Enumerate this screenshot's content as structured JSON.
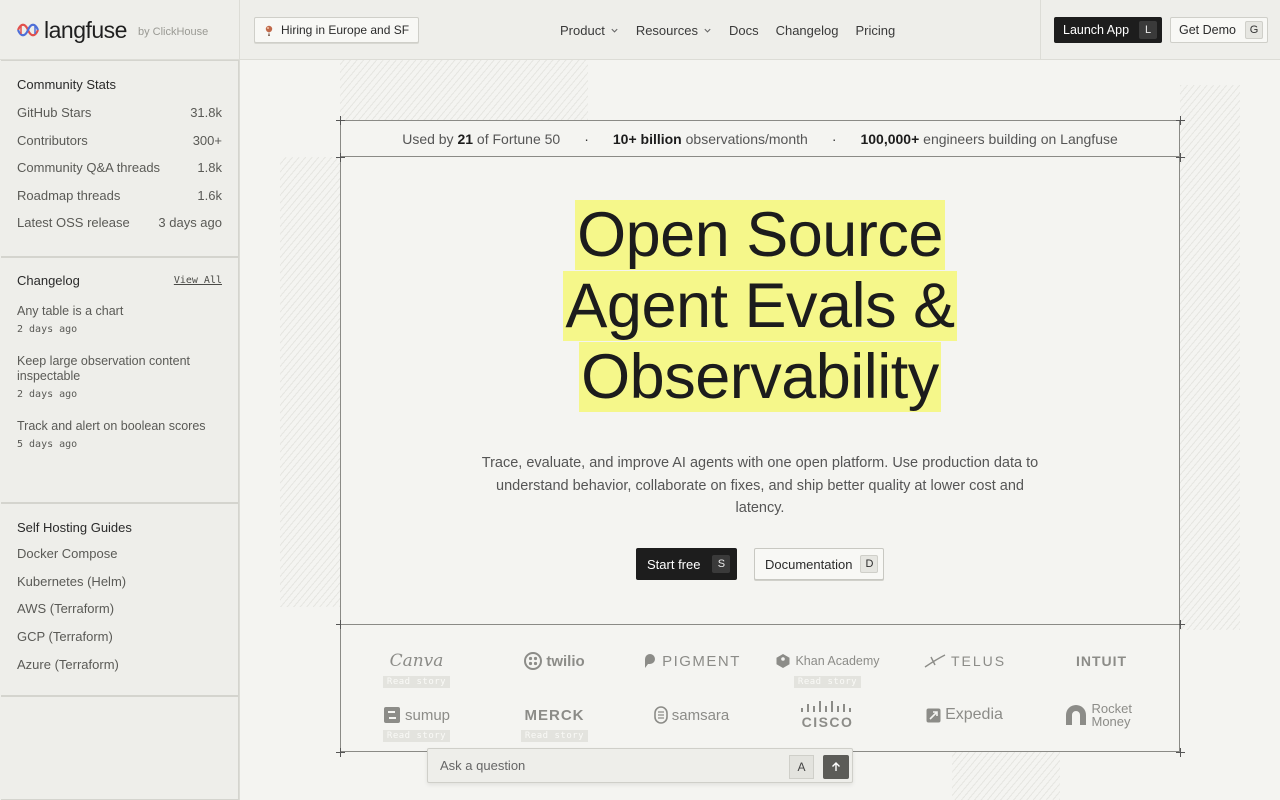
{
  "header": {
    "logo_text": "langfuse",
    "logo_by": "by ClickHouse",
    "hiring": "Hiring in Europe and SF",
    "nav": [
      {
        "label": "Product"
      },
      {
        "label": "Resources"
      },
      {
        "label": "Docs"
      },
      {
        "label": "Changelog"
      },
      {
        "label": "Pricing"
      }
    ],
    "launch": {
      "label": "Launch App",
      "key": "L"
    },
    "demo": {
      "label": "Get Demo",
      "key": "G"
    }
  },
  "sidebar": {
    "community": {
      "title": "Community Stats",
      "rows": [
        {
          "label": "GitHub Stars",
          "value": "31.8k"
        },
        {
          "label": "Contributors",
          "value": "300+"
        },
        {
          "label": "Community Q&A threads",
          "value": "1.8k"
        },
        {
          "label": "Roadmap threads",
          "value": "1.6k"
        },
        {
          "label": "Latest OSS release",
          "value": "3 days ago"
        }
      ]
    },
    "changelog": {
      "title": "Changelog",
      "view_all": "View All",
      "items": [
        {
          "title": "Any table is a chart",
          "date": "2 days ago"
        },
        {
          "title": "Keep large observation content inspectable",
          "date": "2 days ago"
        },
        {
          "title": "Track and alert on boolean scores",
          "date": "5 days ago"
        }
      ]
    },
    "guides": {
      "title": "Self Hosting Guides",
      "items": [
        "Docker Compose",
        "Kubernetes (Helm)",
        "AWS (Terraform)",
        "GCP (Terraform)",
        "Azure (Terraform)"
      ]
    }
  },
  "stats": {
    "s1_pre": "Used by",
    "s1_bold": "21",
    "s1_post": "of Fortune 50",
    "sep": "·",
    "s2_bold": "10+ billion",
    "s2_post": "observations/month",
    "s3_bold": "100,000+",
    "s3_post": "engineers building on Langfuse"
  },
  "hero": {
    "line1": "Open Source",
    "line2": "Agent Evals &",
    "line3": "Observability",
    "subtitle": "Trace, evaluate, and improve AI agents with one open platform. Use production data to understand behavior, collaborate on fixes, and ship better quality at lower cost and latency.",
    "cta_primary": {
      "label": "Start free",
      "key": "S"
    },
    "cta_secondary": {
      "label": "Documentation",
      "key": "D"
    }
  },
  "logos": {
    "read_story": "Read story",
    "row1": [
      "Canva",
      "twilio",
      "PIGMENT",
      "Khan Academy",
      "TELUS",
      "INTUIT"
    ],
    "row2": [
      "sumup",
      "MERCK",
      "samsara",
      "CISCO",
      "Expedia",
      "Rocket Money"
    ]
  },
  "ask": {
    "placeholder": "Ask a question",
    "key": "A"
  }
}
